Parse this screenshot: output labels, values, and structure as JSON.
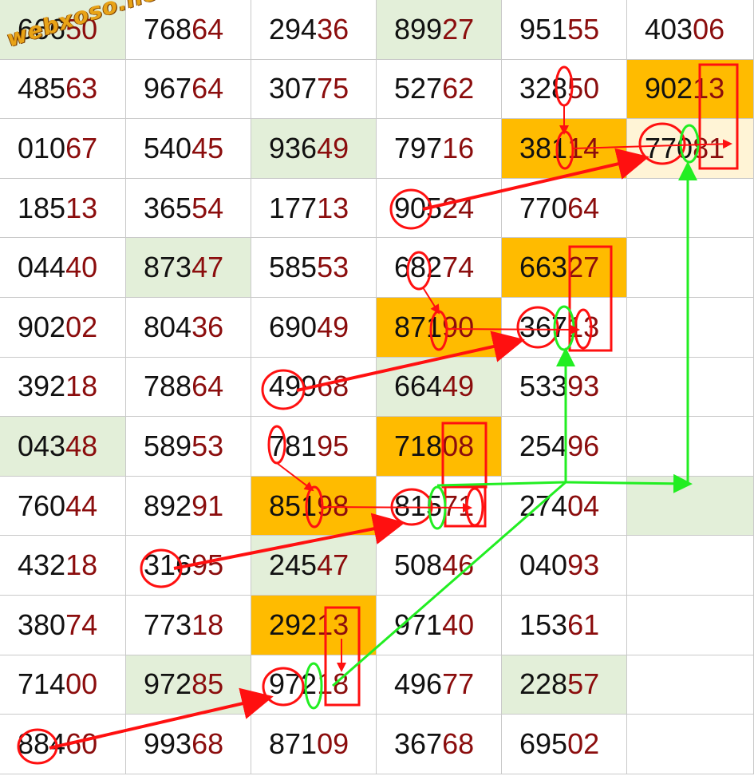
{
  "watermark": "webxoso.net",
  "colors": {
    "gold": "#ffbb00",
    "light_green": "#e3efd9",
    "head_digits": "#111111",
    "tail_digits": "#8b0d0d",
    "marker_red": "#ff1010",
    "marker_green": "#22ee22"
  },
  "rows": [
    [
      {
        "n": "66650",
        "bg": "green"
      },
      {
        "n": "76864"
      },
      {
        "n": "29436"
      },
      {
        "n": "89927",
        "bg": "green"
      },
      {
        "n": "95155"
      },
      {
        "n": "40306"
      }
    ],
    [
      {
        "n": "48563"
      },
      {
        "n": "96764"
      },
      {
        "n": "30775"
      },
      {
        "n": "52762"
      },
      {
        "n": "32850"
      },
      {
        "n": "90213",
        "bg": "gold"
      }
    ],
    [
      {
        "n": "01067"
      },
      {
        "n": "54045"
      },
      {
        "n": "93649",
        "bg": "green"
      },
      {
        "n": "79716"
      },
      {
        "n": "38114",
        "bg": "gold"
      },
      {
        "n": "77081",
        "bg": "pale"
      }
    ],
    [
      {
        "n": "18513"
      },
      {
        "n": "36554"
      },
      {
        "n": "17713"
      },
      {
        "n": "90524"
      },
      {
        "n": "77064"
      },
      {
        "n": ""
      }
    ],
    [
      {
        "n": "04440"
      },
      {
        "n": "87347",
        "bg": "green"
      },
      {
        "n": "58553"
      },
      {
        "n": "68274"
      },
      {
        "n": "66327",
        "bg": "gold"
      },
      {
        "n": ""
      }
    ],
    [
      {
        "n": "90202"
      },
      {
        "n": "80436"
      },
      {
        "n": "69049"
      },
      {
        "n": "87190",
        "bg": "gold"
      },
      {
        "n": "36713"
      },
      {
        "n": ""
      }
    ],
    [
      {
        "n": "39218"
      },
      {
        "n": "78864"
      },
      {
        "n": "49968"
      },
      {
        "n": "66449",
        "bg": "green"
      },
      {
        "n": "53393"
      },
      {
        "n": ""
      }
    ],
    [
      {
        "n": "04348",
        "bg": "green"
      },
      {
        "n": "58953"
      },
      {
        "n": "78195"
      },
      {
        "n": "71808",
        "bg": "gold"
      },
      {
        "n": "25496"
      },
      {
        "n": ""
      }
    ],
    [
      {
        "n": "76044"
      },
      {
        "n": "89291"
      },
      {
        "n": "85198",
        "bg": "gold"
      },
      {
        "n": "81571"
      },
      {
        "n": "27404"
      },
      {
        "n": "",
        "bg": "green"
      }
    ],
    [
      {
        "n": "43218"
      },
      {
        "n": "31695"
      },
      {
        "n": "24547",
        "bg": "green"
      },
      {
        "n": "50846"
      },
      {
        "n": "04093"
      },
      {
        "n": ""
      }
    ],
    [
      {
        "n": "38074"
      },
      {
        "n": "77318"
      },
      {
        "n": "29213",
        "bg": "gold"
      },
      {
        "n": "97140"
      },
      {
        "n": "15361"
      },
      {
        "n": ""
      }
    ],
    [
      {
        "n": "71400"
      },
      {
        "n": "97285",
        "bg": "green"
      },
      {
        "n": "97218"
      },
      {
        "n": "49677"
      },
      {
        "n": "22857",
        "bg": "green"
      },
      {
        "n": ""
      }
    ],
    [
      {
        "n": "88460"
      },
      {
        "n": "99368"
      },
      {
        "n": "87109"
      },
      {
        "n": "36768"
      },
      {
        "n": "69502"
      },
      {
        "n": ""
      }
    ]
  ]
}
